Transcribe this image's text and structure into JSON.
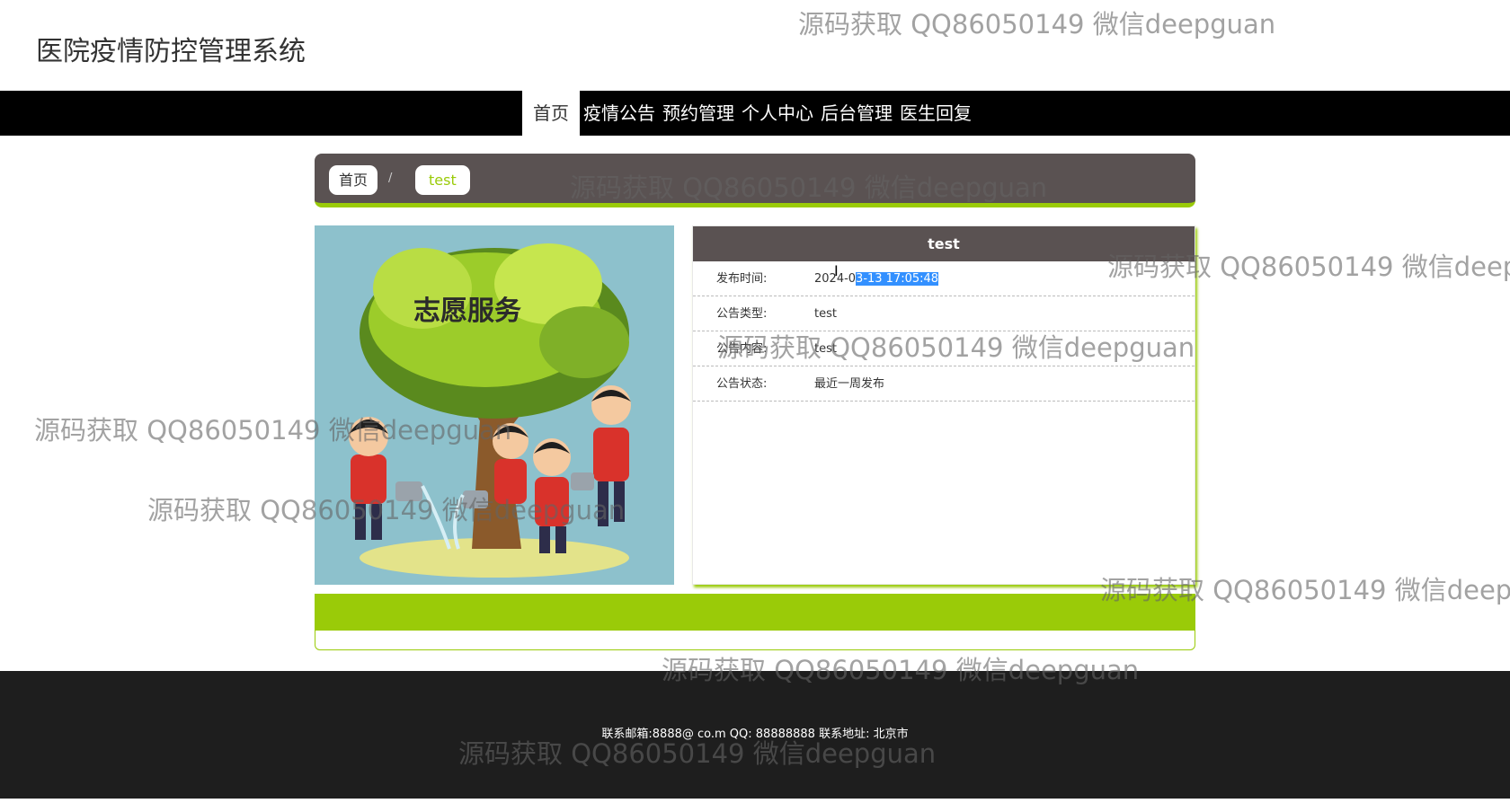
{
  "site": {
    "title": "医院疫情防控管理系统"
  },
  "nav": {
    "items": [
      {
        "label": "首页",
        "active": true
      },
      {
        "label": "疫情公告",
        "active": false
      },
      {
        "label": "预约管理",
        "active": false
      },
      {
        "label": "个人中心",
        "active": false
      },
      {
        "label": "后台管理",
        "active": false
      },
      {
        "label": "医生回复",
        "active": false
      }
    ]
  },
  "breadcrumb": {
    "home": "首页",
    "separator": "/",
    "current": "test"
  },
  "image": {
    "caption": "志愿服务"
  },
  "detail": {
    "title": "test",
    "rows": [
      {
        "label": "发布时间:",
        "value_prefix": "2024-0",
        "value_selected": "3-13 17:05:48"
      },
      {
        "label": "公告类型:",
        "value": "test"
      },
      {
        "label": "公告内容:",
        "value": "test"
      },
      {
        "label": "公告状态:",
        "value": "最近一周发布"
      }
    ]
  },
  "footer": {
    "text": "联系邮箱:8888@ co.m QQ: 88888888 联系地址: 北京市"
  },
  "watermark": {
    "text": "源码获取 QQ86050149 微信deepguan"
  },
  "colors": {
    "accent": "#9acb08",
    "dark": "#5a5252",
    "navbar": "#000000",
    "footer": "#1e1e1e"
  }
}
